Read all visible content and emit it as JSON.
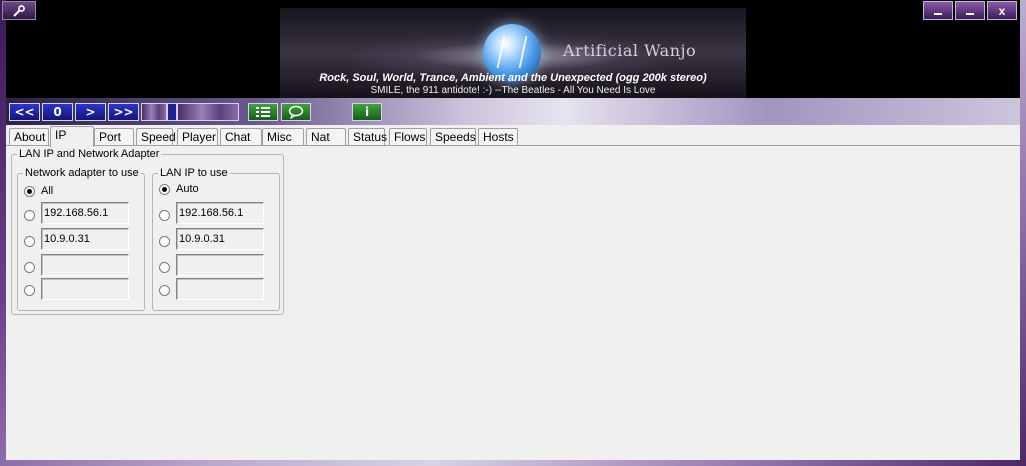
{
  "banner": {
    "brand": "Artificial Wanjo",
    "tagline": "Rock, Soul, World, Trance, Ambient and the  Unexpected  (ogg 200k stereo)",
    "now_playing": "SMILE, the 911 antidote! :-) --The Beatles - All You Need Is Love"
  },
  "window": {
    "minimize_icon": "minimize-icon",
    "restore_icon": "restore-icon",
    "close_label": "x"
  },
  "toolbar": {
    "rewind_label": "<<",
    "stop_label": "0",
    "play_label": ">",
    "forward_label": ">>",
    "info_label": "i",
    "colors": {
      "blue": "#1a1aa0",
      "green": "#2e7d2c"
    }
  },
  "tabs": [
    "About",
    "IP",
    "Port",
    "Speed",
    "Player",
    "Chat",
    "Misc",
    "Nat",
    "Status",
    "Flows",
    "Speeds",
    "Hosts"
  ],
  "active_tab": "IP",
  "ip": {
    "group_title": "LAN IP and Network Adapter",
    "adapter": {
      "title": "Network adapter to use",
      "all_label": "All",
      "fields": [
        "192.168.56.1",
        "10.9.0.31",
        "",
        ""
      ]
    },
    "lan_ip": {
      "title": "LAN IP to use",
      "auto_label": "Auto",
      "fields": [
        "192.168.56.1",
        "10.9.0.31",
        "",
        ""
      ]
    }
  }
}
